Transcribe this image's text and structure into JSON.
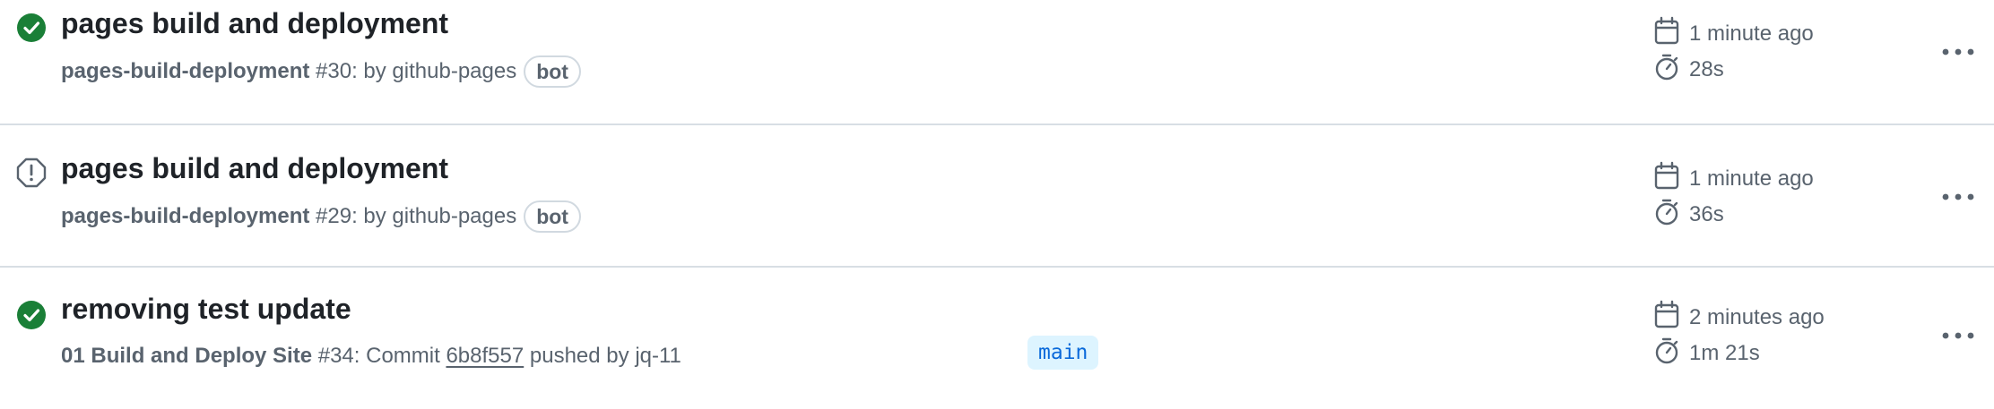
{
  "runs": [
    {
      "status": "success",
      "status_icon": "check-circle-icon",
      "status_color": "#1a7f37",
      "title": "pages build and deployment",
      "workflow": "pages-build-deployment",
      "run_number": "#30",
      "trigger_text": ": by github-pages",
      "badge": "bot",
      "started": "1 minute ago",
      "duration": "28s"
    },
    {
      "status": "startup_failure",
      "status_icon": "stop-octagon-icon",
      "status_color": "#59636e",
      "title": "pages build and deployment",
      "workflow": "pages-build-deployment",
      "run_number": "#29",
      "trigger_text": ": by github-pages",
      "badge": "bot",
      "started": "1 minute ago",
      "duration": "36s"
    },
    {
      "status": "success",
      "status_icon": "check-circle-icon",
      "status_color": "#1a7f37",
      "title": "removing test update",
      "workflow": "01 Build and Deploy Site",
      "run_number": "#34",
      "trigger_prefix": ": Commit",
      "commit_sha": "6b8f557",
      "trigger_suffix": "pushed by jq-11",
      "branch": "main",
      "started": "2 minutes ago",
      "duration": "1m 21s"
    }
  ],
  "colors": {
    "accent": "#0969da",
    "success": "#1a7f37",
    "muted": "#59636e",
    "border": "#d8dee4",
    "branch_bg": "#ddf4ff"
  }
}
